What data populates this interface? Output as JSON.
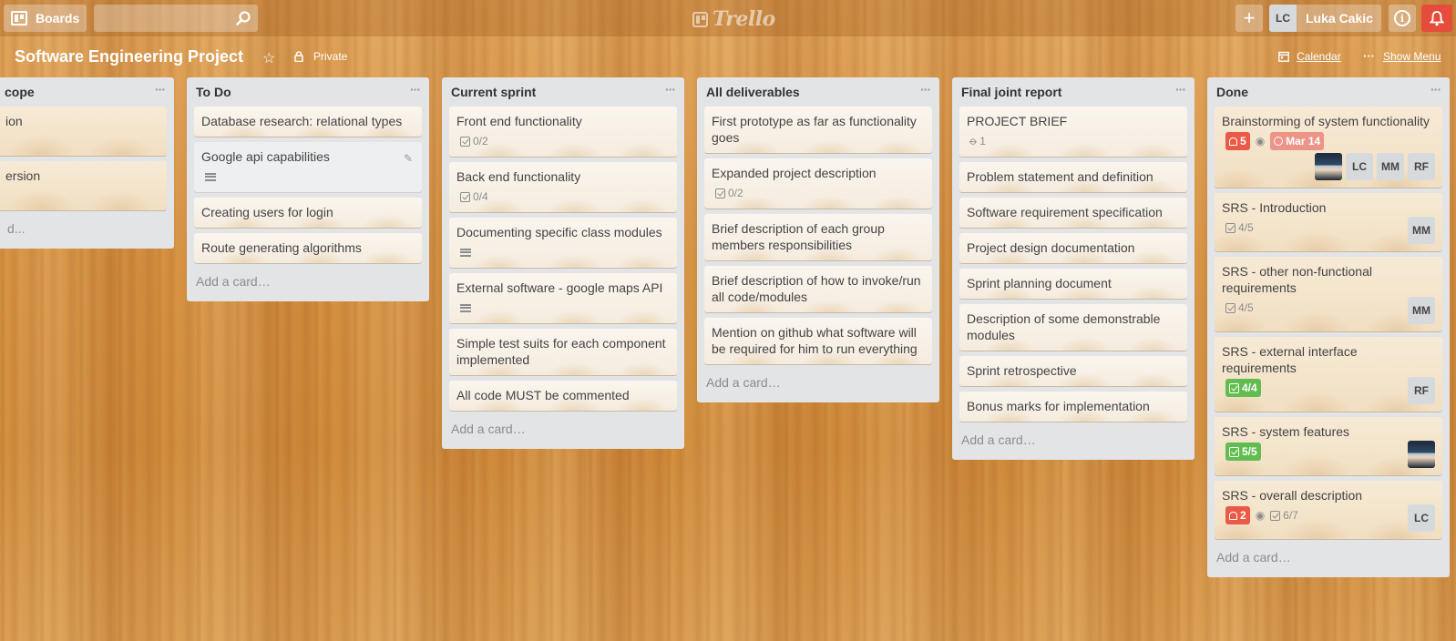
{
  "header": {
    "boards_label": "Boards",
    "search_placeholder": "",
    "logo_text": "Trello",
    "plus_label": "+",
    "member_initials": "LC",
    "member_name": "Luka Cakic",
    "info_label": "i"
  },
  "board": {
    "title": "Software Engineering Project",
    "visibility": "Private",
    "calendar_label": "Calendar",
    "dots": "···",
    "show_menu_label": "Show Menu"
  },
  "lists": [
    {
      "title": "cope",
      "menu": "···",
      "cards": [
        {
          "title": "ion"
        },
        {
          "title": "ersion"
        }
      ],
      "add_card": "d..."
    },
    {
      "title": "To Do",
      "menu": "···",
      "cards": [
        {
          "title": "Database research: relational types"
        },
        {
          "title": "Google api capabilities"
        },
        {
          "title": "Creating users for login"
        },
        {
          "title": "Route generating algorithms"
        }
      ],
      "add_card": "Add a card…"
    },
    {
      "title": "Current sprint",
      "menu": "···",
      "cards": [
        {
          "title": "Front end functionality",
          "checklist": "0/2"
        },
        {
          "title": "Back end functionality",
          "checklist": "0/4"
        },
        {
          "title": "Documenting specific class modules"
        },
        {
          "title": "External software - google maps API"
        },
        {
          "title": "Simple test suits for each component implemented"
        },
        {
          "title": "All code MUST be commented"
        }
      ],
      "add_card": "Add a card…"
    },
    {
      "title": "All deliverables",
      "menu": "···",
      "cards": [
        {
          "title": "First prototype as far as functionality goes"
        },
        {
          "title": "Expanded project description",
          "checklist": "0/2"
        },
        {
          "title": "Brief description of each group members responsibilities"
        },
        {
          "title": "Brief description of how to invoke/run all code/modules"
        },
        {
          "title": "Mention on github what software will be required for him to run everything"
        }
      ],
      "add_card": "Add a card…"
    },
    {
      "title": "Final joint report",
      "menu": "···",
      "cards": [
        {
          "title": "PROJECT BRIEF",
          "attachments": "1"
        },
        {
          "title": "Problem statement and definition"
        },
        {
          "title": "Software requirement specification"
        },
        {
          "title": "Project design documentation"
        },
        {
          "title": "Sprint planning document"
        },
        {
          "title": "Description of some demonstrable modules"
        },
        {
          "title": "Sprint retrospective"
        },
        {
          "title": "Bonus marks for implementation"
        }
      ],
      "add_card": "Add a card…"
    },
    {
      "title": "Done",
      "menu": "···",
      "cards": [
        {
          "title": "Brainstorming of system functionality",
          "notifications": "5",
          "due": "Mar 14",
          "members": [
            "LC",
            "MM",
            "RF"
          ]
        },
        {
          "title": "SRS - Introduction",
          "checklist": "4/5",
          "members": [
            "MM"
          ]
        },
        {
          "title": "SRS - other non-functional requirements",
          "checklist": "4/5",
          "members": [
            "MM"
          ]
        },
        {
          "title": "SRS - external interface requirements",
          "checklist": "4/4",
          "members": [
            "RF"
          ]
        },
        {
          "title": "SRS - system features",
          "checklist": "5/5"
        },
        {
          "title": "SRS - overall description",
          "notifications": "2",
          "checklist": "6/7",
          "members": [
            "LC"
          ]
        }
      ],
      "add_card": "Add a card…"
    }
  ],
  "colors": {
    "badge_green": "#61bd4f",
    "badge_red": "#eb5a46",
    "badge_due": "#ec9488",
    "notification_button": "#e64c3c",
    "list_background": "#e2e4e6"
  }
}
